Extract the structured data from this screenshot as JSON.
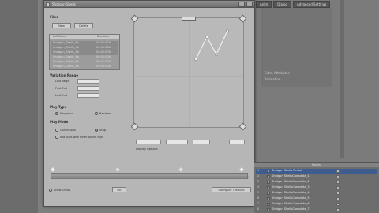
{
  "host": {
    "tabs": [
      "Anim",
      "Dialog",
      "Advanced Settings"
    ],
    "right_panel": {
      "label_1": "Extra Attributes",
      "label_2": "Animation"
    }
  },
  "dialog": {
    "title": "Shotgun Shells",
    "files_section": "Files",
    "new_button": "New",
    "delete_button": "Delete",
    "list_headers": [
      "Full Name",
      "Duration"
    ],
    "list_rows": [
      {
        "name": "Shotgun_Shells_Ro",
        "duration": "00:01:000"
      },
      {
        "name": "Shotgun_Shells_Ro",
        "duration": "00:01:000"
      },
      {
        "name": "Shotgun_Shells_Ro",
        "duration": "00:01:000"
      },
      {
        "name": "Shotgun_Shells_Ro",
        "duration": "00:01:000"
      },
      {
        "name": "Shotgun_Shells_Ro",
        "duration": "00:01:000"
      },
      {
        "name": "Shotgun_Shells_Ro",
        "duration": "00:01:000"
      }
    ],
    "variation_section": "Variation Range",
    "last_begin_label": "Last Begin",
    "first_end_label": "First End",
    "last_end_label": "Last End",
    "play_type_section": "Play Type",
    "sequence_label": "Sequence",
    "random_label": "Random",
    "play_mode_section": "Play Mode",
    "continuous_label": "Continuous",
    "stop_label": "Stop",
    "no_sound_label": "Not start with other sound clips",
    "display_options": "Display Options",
    "configure_button": "Configure Timeline",
    "show_limits_label": "Show Limits",
    "ok_button": "OK"
  },
  "outliner": {
    "header": "Playlist",
    "rows": [
      {
        "n": "1",
        "t": "Shotgun Shells Rental",
        "sel": true
      },
      {
        "n": "2",
        "t": "Shotgun ShellsCrossdata_1",
        "sel": false
      },
      {
        "n": "3",
        "t": "Shotgun ShellsCrossdata_2",
        "sel": false
      },
      {
        "n": "4",
        "t": "Shotgun ShellsCrossdata_3",
        "sel": false
      },
      {
        "n": "5",
        "t": "Shotgun ShellsCrossdata_4",
        "sel": false
      },
      {
        "n": "6",
        "t": "Shotgun ShellsCrossdata_5",
        "sel": false
      },
      {
        "n": "7",
        "t": "Shotgun ShellsCrossdata_6",
        "sel": false
      },
      {
        "n": "8",
        "t": "Shotgun ShellsCrossdata_7",
        "sel": false
      }
    ]
  }
}
